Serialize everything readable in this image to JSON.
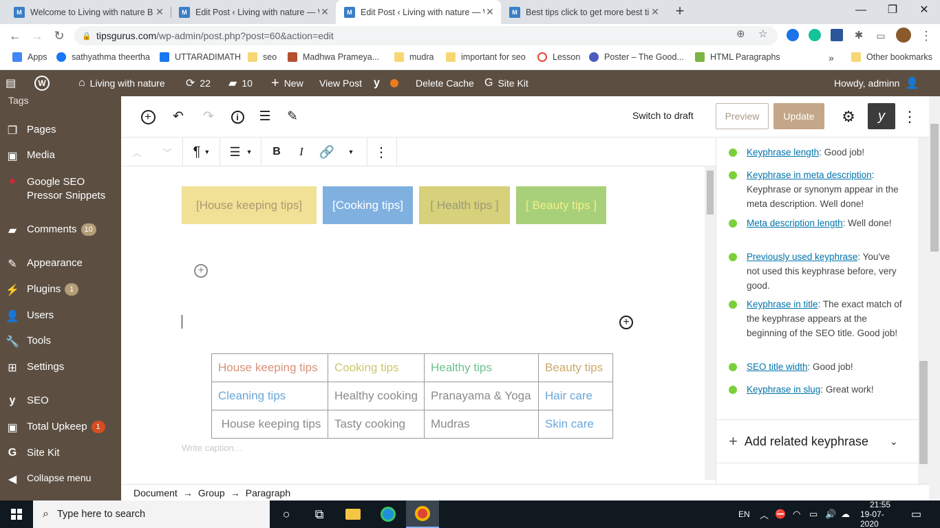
{
  "browser": {
    "tabs": [
      {
        "title": "Welcome to Living with nature B",
        "fav": "M"
      },
      {
        "title": "Edit Post ‹ Living with nature — W",
        "fav": "M"
      },
      {
        "title": "Edit Post ‹ Living with nature — W",
        "fav": "M",
        "active": true
      },
      {
        "title": "Best tips click to get more best ti",
        "fav": "M"
      }
    ],
    "url_host": "tipsgurus.com",
    "url_path": "/wp-admin/post.php?post=60&action=edit",
    "bookmarks": [
      {
        "label": "Apps",
        "color": "#4285f4"
      },
      {
        "label": "sathyathma theertha",
        "color": "#1877f2"
      },
      {
        "label": "UTTARADIMATH",
        "color": "#1877f2"
      },
      {
        "label": "seo",
        "color": "#f7d774"
      },
      {
        "label": "Madhwa Prameya...",
        "color": "#b5502e"
      },
      {
        "label": "mudra",
        "color": "#f7d774"
      },
      {
        "label": "important for seo",
        "color": "#f7d774"
      },
      {
        "label": "Lesson",
        "color": "#ea4335"
      },
      {
        "label": "Poster – The Good...",
        "color": "#4a5cbf"
      },
      {
        "label": "HTML Paragraphs",
        "color": "#7cb342"
      }
    ],
    "bookmarks_more": "»",
    "other_bookmarks": "Other bookmarks"
  },
  "adminbar": {
    "site": "Living with nature",
    "updates": "22",
    "comments": "10",
    "new": "New",
    "view_post": "View Post",
    "delete_cache": "Delete Cache",
    "site_kit": "Site Kit",
    "howdy": "Howdy, adminn"
  },
  "menu": {
    "partial_top": "Tags",
    "items": [
      {
        "label": "Pages",
        "icon": "pages-icon"
      },
      {
        "label": "Media",
        "icon": "media-icon"
      },
      {
        "label": "Google SEO Pressor Snippets",
        "icon": "google-seo-icon"
      },
      {
        "label": "Comments",
        "icon": "comments-icon",
        "badge": "10"
      },
      {
        "label": "Appearance",
        "icon": "appearance-icon"
      },
      {
        "label": "Plugins",
        "icon": "plugins-icon",
        "badge": "1"
      },
      {
        "label": "Users",
        "icon": "users-icon"
      },
      {
        "label": "Tools",
        "icon": "tools-icon"
      },
      {
        "label": "Settings",
        "icon": "settings-icon"
      },
      {
        "label": "SEO",
        "icon": "seo-icon"
      },
      {
        "label": "Total Upkeep",
        "icon": "total-upkeep-icon",
        "badge": "1"
      },
      {
        "label": "Site Kit",
        "icon": "site-kit-icon"
      },
      {
        "label": "Collapse menu",
        "icon": "collapse-icon"
      }
    ]
  },
  "editor": {
    "switch_to_draft": "Switch to draft",
    "preview": "Preview",
    "update": "Update",
    "tip_buttons": [
      {
        "label": "[House  keeping tips]",
        "bg": "#f0e196",
        "color": "#a89a74"
      },
      {
        "label": "[Cooking tips]",
        "bg": "#7fb0e0",
        "color": "#ffffff"
      },
      {
        "label": "[ Health tips ]",
        "bg": "#d6d17a",
        "color": "#9a9a7a"
      },
      {
        "label": "[ Beauty tips ]",
        "bg": "#a8d07a",
        "color": "#f4ee8a"
      }
    ],
    "table": [
      [
        {
          "t": "House keeping tips",
          "c": "#d8927a"
        },
        {
          "t": "Cooking tips",
          "c": "#c9c96a"
        },
        {
          "t": "Healthy tips",
          "c": "#6cc28e"
        },
        {
          "t": "Beauty tips",
          "c": "#caa96a"
        }
      ],
      [
        {
          "t": "Cleaning tips",
          "c": "#6aa6d8"
        },
        {
          "t": "Healthy cooking",
          "c": "#8a8a8a"
        },
        {
          "t": "Pranayama & Yoga",
          "c": "#8a8a8a"
        },
        {
          "t": "Hair care",
          "c": "#6aa6d8"
        }
      ],
      [
        {
          "t": " House keeping tips",
          "c": "#8a8a8a"
        },
        {
          "t": "Tasty cooking",
          "c": "#8a8a8a"
        },
        {
          "t": "Mudras",
          "c": "#8a8a8a"
        },
        {
          "t": "Skin care",
          "c": "#6aa6d8"
        }
      ]
    ],
    "caption_placeholder": "Write caption…"
  },
  "seo_checks": [
    {
      "link": "Keyphrase length",
      "text": ": Good job!"
    },
    {
      "link": "Keyphrase in meta description",
      "text": ": Keyphrase or synonym appear in the meta description. Well done!"
    },
    {
      "link": "Meta description length",
      "text": ": Well done!"
    },
    {
      "link": "Previously used keyphrase",
      "text": ": You've not used this keyphrase before, very good."
    },
    {
      "link": "Keyphrase in title",
      "text": ": The exact match of the keyphrase appears at the beginning of the SEO title. Good job!"
    },
    {
      "link": "SEO title width",
      "text": ": Good job!"
    },
    {
      "link": "Keyphrase in slug",
      "text": ": Great work!"
    }
  ],
  "add_related_keyphrase": "Add related keyphrase",
  "breadcrumb": [
    "Document",
    "Group",
    "Paragraph"
  ],
  "breadcrumb_sep": "→",
  "taskbar": {
    "search_placeholder": "Type here to search",
    "lang": "EN",
    "time": "21:55",
    "date": "19-07-2020"
  },
  "colors": {
    "admin_bg": "#5c4f42",
    "update_btn": "#c4a688",
    "check_green": "#7ad03a",
    "link": "#0073aa"
  }
}
